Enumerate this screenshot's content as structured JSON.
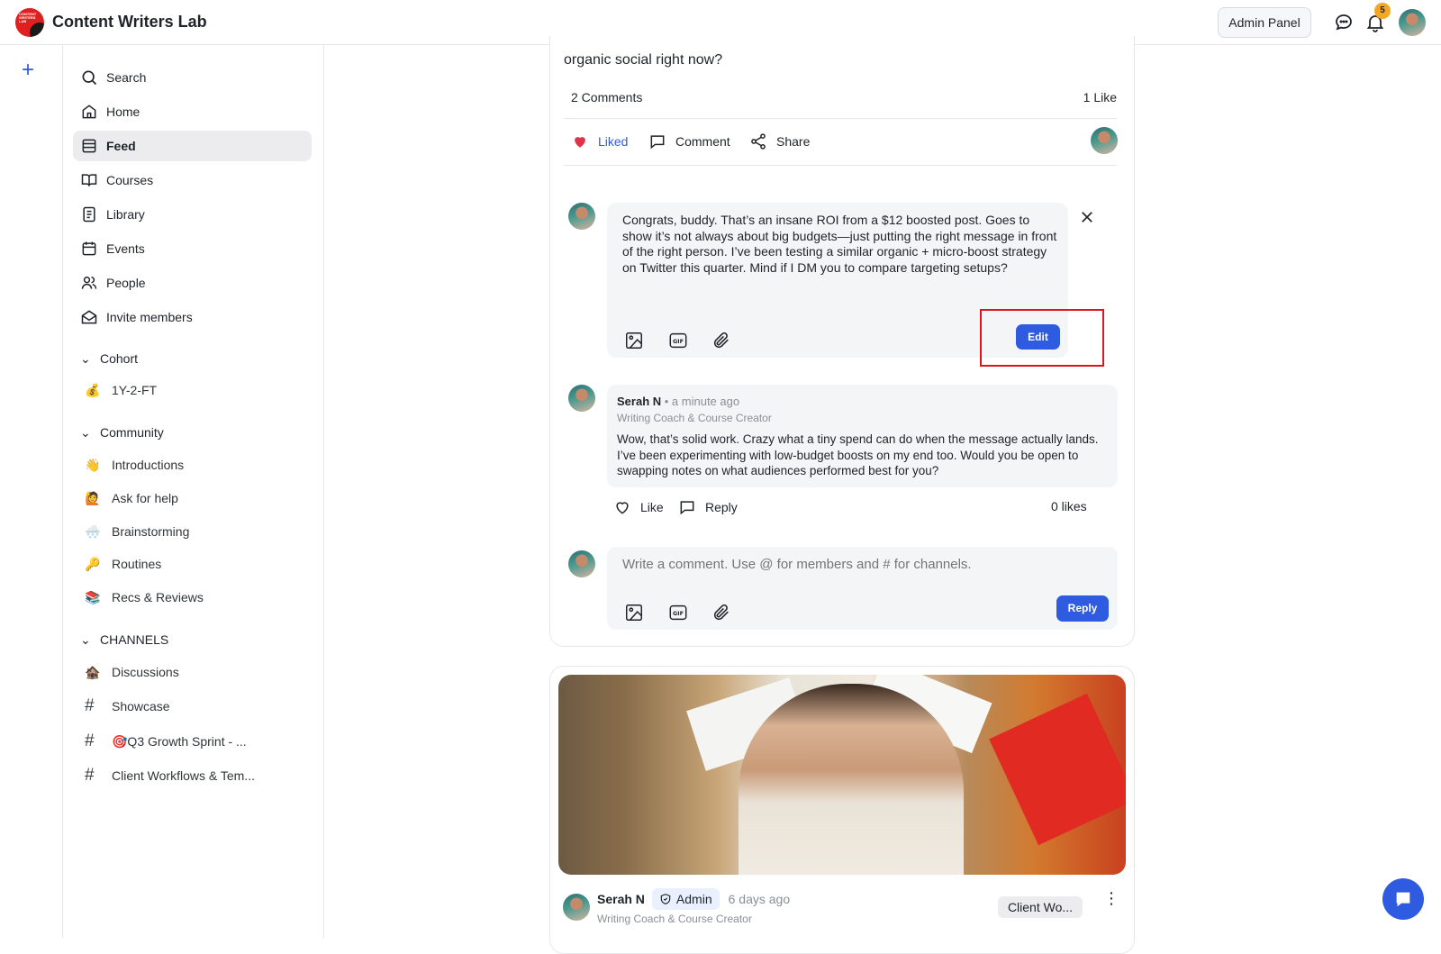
{
  "app": {
    "title": "Content Writers Lab",
    "logo_text": "CONTENT WRITERS LAB"
  },
  "header": {
    "admin_panel_label": "Admin Panel",
    "notification_count": "5"
  },
  "sidebar": {
    "nav": [
      {
        "label": "Search",
        "icon": "search-icon"
      },
      {
        "label": "Home",
        "icon": "home-icon"
      },
      {
        "label": "Feed",
        "icon": "feed-icon",
        "active": true
      },
      {
        "label": "Courses",
        "icon": "book-icon"
      },
      {
        "label": "Library",
        "icon": "document-icon"
      },
      {
        "label": "Events",
        "icon": "calendar-icon"
      },
      {
        "label": "People",
        "icon": "people-icon"
      },
      {
        "label": "Invite members",
        "icon": "mail-icon"
      }
    ],
    "cohort": {
      "title": "Cohort",
      "items": [
        {
          "emoji": "💰",
          "label": "1Y-2-FT"
        }
      ]
    },
    "community": {
      "title": "Community",
      "items": [
        {
          "emoji": "👋",
          "label": "Introductions"
        },
        {
          "emoji": "🙋",
          "label": "Ask for help"
        },
        {
          "emoji": "🌨️",
          "label": "Brainstorming"
        },
        {
          "emoji": "🔑",
          "label": "Routines"
        },
        {
          "emoji": "📚",
          "label": "Recs & Reviews"
        }
      ]
    },
    "channels": {
      "title": "CHANNELS",
      "items": [
        {
          "emoji": "🏚️",
          "label": "Discussions"
        },
        {
          "emoji": "#",
          "label": "Showcase"
        },
        {
          "emoji": "#",
          "label": "🎯Q3 Growth Sprint - ..."
        },
        {
          "emoji": "#",
          "label": "Client Workflows & Tem..."
        }
      ]
    }
  },
  "post": {
    "text": "organic social right now?",
    "comments_count": "2 Comments",
    "likes_count": "1 Like",
    "actions": {
      "liked": "Liked",
      "comment": "Comment",
      "share": "Share"
    }
  },
  "edit_comment": {
    "text": "Congrats, buddy. That’s an insane ROI from a $12 boosted post. Goes to show it’s not always about big budgets—just putting the right message in front of the right person. I’ve been testing a similar organic + micro-boost strategy on Twitter this quarter. Mind if I DM you to compare targeting setups?",
    "button": "Edit"
  },
  "comment": {
    "author": "Serah N",
    "time": "• a minute ago",
    "role": "Writing Coach & Course Creator",
    "text": "Wow, that’s solid work. Crazy what a tiny spend can do when the message actually lands. I’ve been experimenting with low-budget boosts on my end too. Would you be open to swapping notes on what audiences performed best for you?",
    "like": "Like",
    "reply": "Reply",
    "likes": "0 likes"
  },
  "composer": {
    "placeholder": "Write a comment. Use @ for members and # for channels.",
    "button": "Reply",
    "gif_label": "GIF"
  },
  "next_post": {
    "author": "Serah N",
    "badge": "Admin",
    "time": "6 days ago",
    "role": "Writing Coach & Course Creator",
    "channel_pill": "Client Wo..."
  },
  "colors": {
    "accent": "#2f5be0",
    "liked": "#e0334a",
    "highlight": "#e0141e"
  }
}
